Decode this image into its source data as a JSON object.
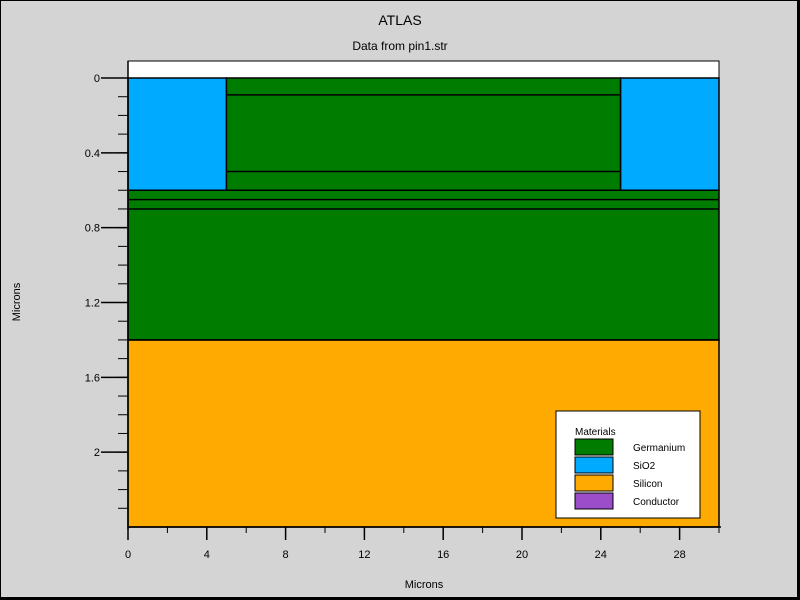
{
  "chart_data": {
    "type": "structure",
    "title": "ATLAS",
    "subtitle": "Data from pin1.str",
    "xlabel": "Microns",
    "ylabel": "Microns",
    "xlim": [
      0,
      30
    ],
    "ylim": [
      0,
      2.4
    ],
    "y_inverted": true,
    "xticks": [
      0,
      4,
      8,
      12,
      16,
      20,
      24,
      28
    ],
    "xtick_labels": [
      "0",
      "4",
      "8",
      "12",
      "16",
      "20",
      "24",
      "28"
    ],
    "yticks": [
      0,
      0.4,
      0.8,
      1.2,
      1.6,
      2
    ],
    "ytick_labels": [
      "0",
      "0.4",
      "0.8",
      "1.2",
      "1.6",
      "2"
    ],
    "colors": {
      "Germanium": "#007c00",
      "SiO2": "#00aaff",
      "Silicon": "#ffaa00",
      "Conductor": "#9b4dca",
      "background": "#d4d4d4",
      "plot_bg": "#ffffff"
    },
    "regions": [
      {
        "material": "Silicon",
        "x": [
          0,
          30
        ],
        "y": [
          1.4,
          2.4
        ]
      },
      {
        "material": "Germanium",
        "x": [
          0,
          30
        ],
        "y": [
          0.6,
          1.4
        ]
      },
      {
        "material": "SiO2",
        "x": [
          0,
          5
        ],
        "y": [
          0,
          0.6
        ]
      },
      {
        "material": "SiO2",
        "x": [
          25,
          30
        ],
        "y": [
          0,
          0.6
        ]
      },
      {
        "material": "Germanium",
        "x": [
          5,
          25
        ],
        "y": [
          0,
          0.6
        ]
      }
    ],
    "horizontal_lines": [
      {
        "x": [
          5,
          25
        ],
        "y": 0.09
      },
      {
        "x": [
          5,
          25
        ],
        "y": 0.5
      },
      {
        "x": [
          0,
          30
        ],
        "y": 0.6
      },
      {
        "x": [
          0,
          30
        ],
        "y": 0.65
      },
      {
        "x": [
          0,
          30
        ],
        "y": 0.7
      },
      {
        "x": [
          0,
          30
        ],
        "y": 1.4
      }
    ],
    "legend": {
      "title": "Materials",
      "position": "bottom-right",
      "entries": [
        {
          "label": "Germanium",
          "material": "Germanium"
        },
        {
          "label": "SiO2",
          "material": "SiO2"
        },
        {
          "label": "Silicon",
          "material": "Silicon"
        },
        {
          "label": "Conductor",
          "material": "Conductor"
        }
      ]
    }
  }
}
